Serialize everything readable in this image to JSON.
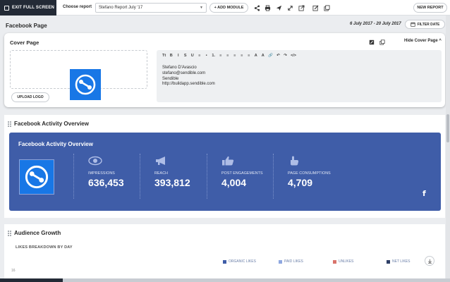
{
  "toolbar": {
    "exit_label": "EXIT FULL SCREEN",
    "choose_label": "Choose report",
    "report_value": "Stefano Report July '17",
    "add_module_label": "+ ADD MODULE",
    "new_report_label": "NEW REPORT",
    "icons": [
      "share-icon",
      "print-icon",
      "send-icon",
      "expand-icon",
      "external-link-icon",
      "edit-icon",
      "copy-icon"
    ]
  },
  "page": {
    "title": "Facebook Page",
    "date_range": "6 July 2017 - 20 July 2017",
    "filter_label": "FILTER DATE"
  },
  "cover": {
    "title": "Cover Page",
    "hide_label": "Hide Cover Page ^",
    "upload_label": "UPLOAD LOGO",
    "editor_toolbar": [
      "Tt",
      "B",
      "I",
      "S",
      "U",
      "≡",
      "•",
      "1.",
      "≡",
      "≡",
      "≡",
      "≡",
      "≡",
      "A",
      "A",
      "🔗",
      "↶",
      "↷",
      "</>"
    ],
    "lines": [
      "Stefano D'Avascio",
      "stefano@sendible.com",
      "Sendible",
      "http://buildapp.sendible.com"
    ]
  },
  "activity": {
    "section_title": "Facebook Activity Overview",
    "panel_title": "Facebook Activity Overview",
    "metrics": [
      {
        "label": "IMPRESSIONS",
        "value": "636,453",
        "icon": "eye-icon"
      },
      {
        "label": "REACH",
        "value": "393,812",
        "icon": "megaphone-icon"
      },
      {
        "label": "POST ENGAGEMENTS",
        "value": "4,004",
        "icon": "thumbs-up-icon"
      },
      {
        "label": "PAGE CONSUMPTIONS",
        "value": "4,709",
        "icon": "hand-point-icon"
      }
    ],
    "brand_color": "#3f5da8"
  },
  "audience": {
    "section_title": "Audience Growth",
    "subtitle": "LIKES BREAKDOWN BY DAY",
    "legend": [
      {
        "label": "ORGANIC LIKES",
        "color": "#3f5da8"
      },
      {
        "label": "PAID LIKES",
        "color": "#8fa8e0"
      },
      {
        "label": "UNLIKES",
        "color": "#d9736b"
      },
      {
        "label": "NET LIKES",
        "color": "#2e3f66"
      }
    ],
    "axis_top": "16"
  },
  "progress": {
    "fraction": 0.14
  }
}
